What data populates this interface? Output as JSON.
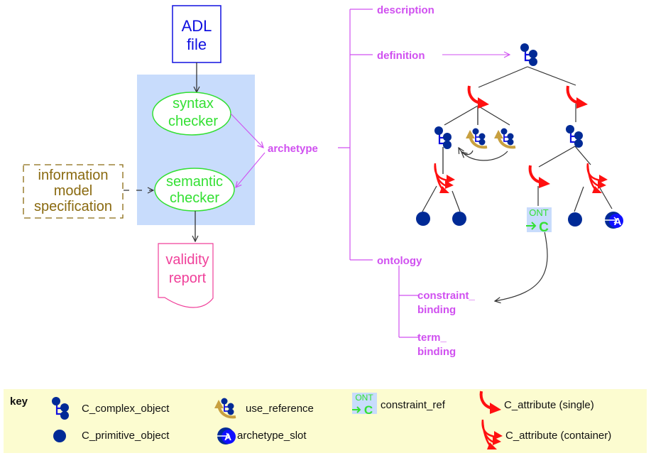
{
  "colors": {
    "adl": "#1010e0",
    "checker": "#33e033",
    "checker_bg": "#c8dcfc",
    "magenta": "#d050f0",
    "info": "#8a6a10",
    "report": "#f0409a",
    "node": "#002a96",
    "attr": "#ff1010",
    "useref": "#c8a040",
    "key_bg": "#fcfcd0"
  },
  "process": {
    "adl_file": [
      "ADL",
      "file"
    ],
    "syntax_checker": [
      "syntax",
      "checker"
    ],
    "semantic_checker": [
      "semantic",
      "checker"
    ],
    "info_model": [
      "information",
      "model",
      "specification"
    ],
    "validity_report": [
      "validity",
      "report"
    ]
  },
  "archetype": {
    "label": "archetype",
    "sections": {
      "description": "description",
      "definition": "definition",
      "ontology": "ontology",
      "constraint_binding": [
        "constraint_",
        "binding"
      ],
      "term_binding": [
        "term_",
        "binding"
      ]
    }
  },
  "tree": {
    "ont_label": "ONT",
    "c_label": "C",
    "slot_label": "A"
  },
  "key": {
    "title": "key",
    "items": [
      {
        "icon": "c-complex-object-icon",
        "label": "C_complex_object"
      },
      {
        "icon": "use-reference-icon",
        "label": "use_reference"
      },
      {
        "icon": "constraint-ref-icon",
        "label": "constraint_ref"
      },
      {
        "icon": "c-attribute-single-icon",
        "label": "C_attribute (single)"
      },
      {
        "icon": "c-primitive-object-icon",
        "label": "C_primitive_object"
      },
      {
        "icon": "archetype-slot-icon",
        "label": "archetype_slot"
      },
      {
        "icon": "c-attribute-container-icon",
        "label": "C_attribute (container)"
      }
    ]
  }
}
